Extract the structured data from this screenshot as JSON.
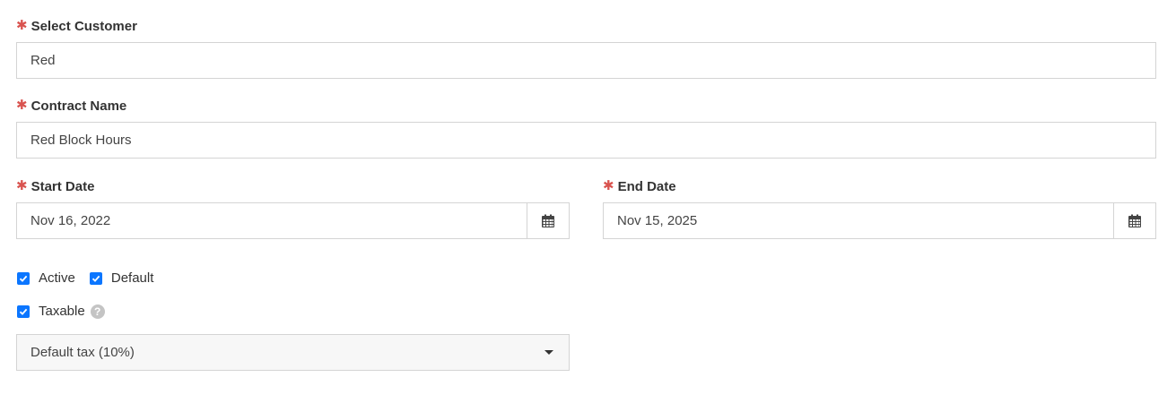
{
  "form": {
    "customer": {
      "label": "Select Customer",
      "value": "Red"
    },
    "contract_name": {
      "label": "Contract Name",
      "value": "Red Block Hours"
    },
    "start_date": {
      "label": "Start Date",
      "value": "Nov 16, 2022"
    },
    "end_date": {
      "label": "End Date",
      "value": "Nov 15, 2025"
    },
    "active": {
      "label": "Active",
      "checked": true
    },
    "default": {
      "label": "Default",
      "checked": true
    },
    "taxable": {
      "label": "Taxable",
      "checked": true
    },
    "tax_select": {
      "value": "Default tax (10%)"
    }
  },
  "colors": {
    "required": "#d9534f",
    "checkbox": "#0b76ff",
    "border": "#d4d4d4"
  },
  "icons": {
    "required": "asterisk-icon",
    "calendar": "calendar-icon",
    "help": "help-icon",
    "dropdown": "caret-down-icon",
    "check": "checkmark-icon"
  }
}
